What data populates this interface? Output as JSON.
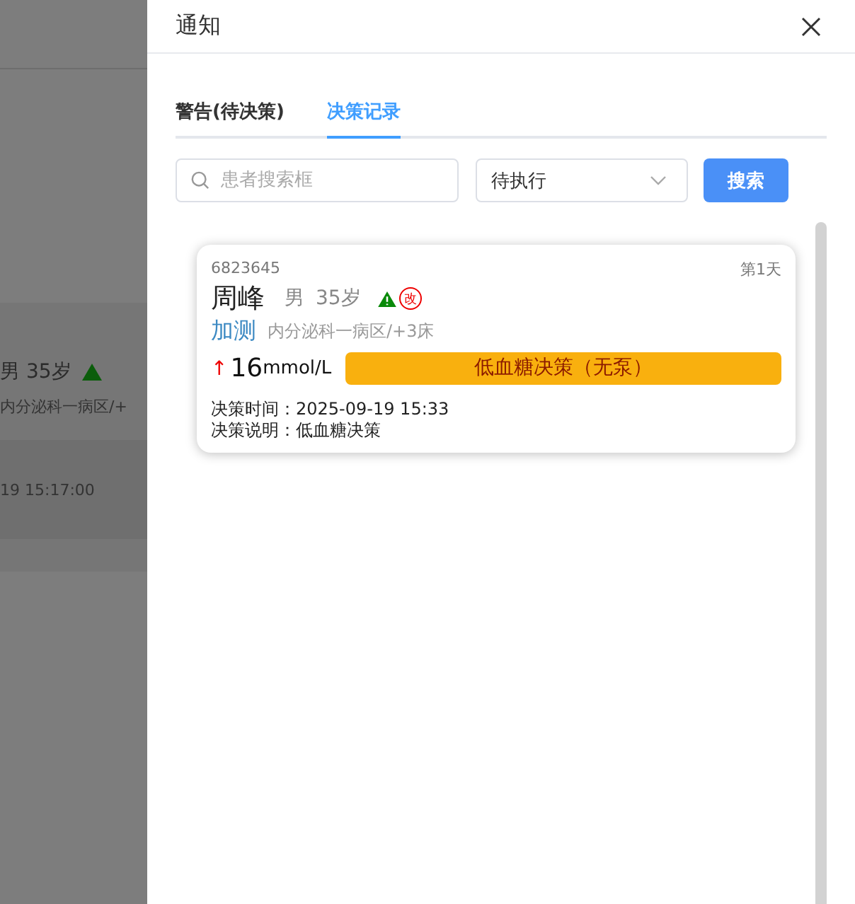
{
  "background": {
    "patient": "男  35岁",
    "ward": "内分泌科一病区/+",
    "time": "19 15:17:00"
  },
  "drawer": {
    "title": "通知"
  },
  "tabs": [
    {
      "label": "警告(待决策)",
      "selected": false
    },
    {
      "label": "决策记录",
      "selected": true
    }
  ],
  "search": {
    "placeholder": "患者搜索框",
    "status": "待执行",
    "button": "搜索"
  },
  "records": [
    {
      "id": "6823645",
      "day": "第1天",
      "name": "周峰",
      "gender": "男",
      "age": "35岁",
      "revised_mark": "改",
      "tag": "加测",
      "ward": "内分泌科一病区/+3床",
      "trend": "↑",
      "value": "16",
      "unit": "mmol/L",
      "decision": "低血糖决策（无泵）",
      "time_label": "决策时间：",
      "time": "2025-09-19 15:33",
      "note_label": "决策说明：",
      "note": "低血糖决策"
    }
  ]
}
